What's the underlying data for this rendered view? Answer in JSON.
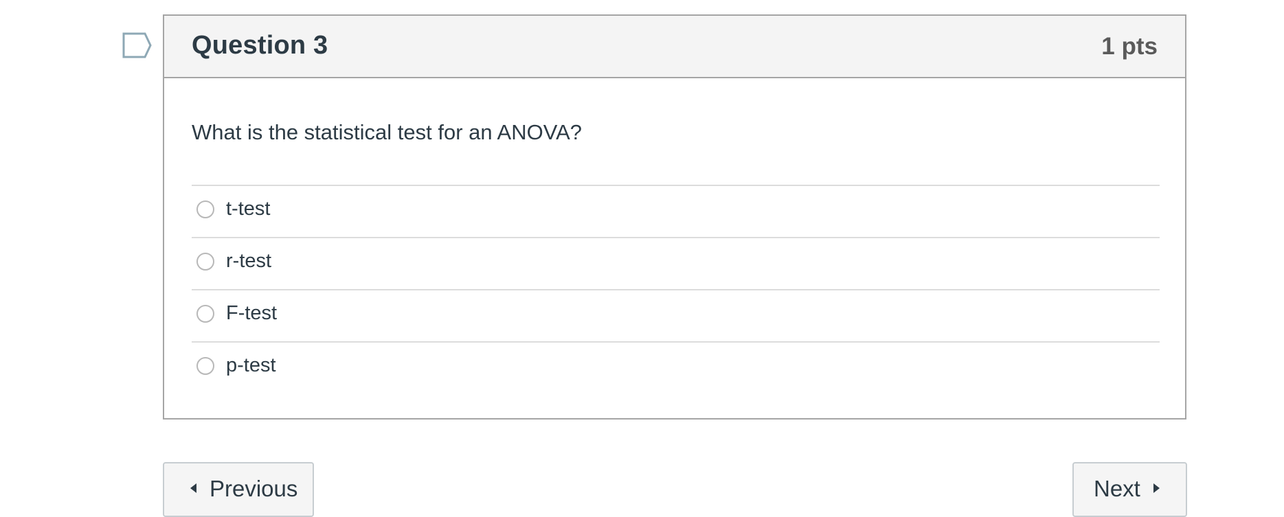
{
  "question": {
    "title": "Question 3",
    "points": "1 pts",
    "text": "What is the statistical test for an ANOVA?",
    "flag_icon": "flag-icon"
  },
  "answers": [
    {
      "label": "t-test",
      "selected": false
    },
    {
      "label": "r-test",
      "selected": false
    },
    {
      "label": "F-test",
      "selected": false
    },
    {
      "label": "p-test",
      "selected": false
    }
  ],
  "navigation": {
    "previous_label": "Previous",
    "next_label": "Next",
    "previous_icon": "caret-left-icon",
    "next_icon": "caret-right-icon"
  },
  "colors": {
    "text": "#2d3b45",
    "header_bg": "#f4f4f4",
    "border": "#a5a5a5",
    "flag": "#8ea8b5"
  }
}
